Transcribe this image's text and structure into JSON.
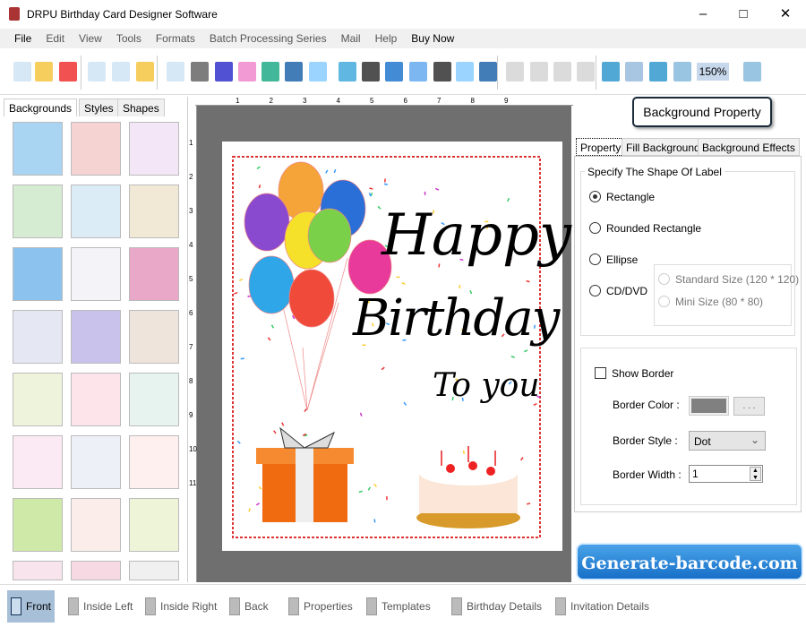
{
  "app": {
    "title": "DRPU Birthday Card Designer Software"
  },
  "menu": [
    "File",
    "Edit",
    "View",
    "Tools",
    "Formats",
    "Batch Processing Series",
    "Mail",
    "Help",
    "Buy Now"
  ],
  "toolbar": {
    "zoom": "150%",
    "icons": [
      "new-icon",
      "open-icon",
      "close-icon",
      "save-icon",
      "save-as-icon",
      "export-icon",
      "page-setup-icon",
      "print-icon",
      "copies-icon",
      "gift-icon",
      "image-icon",
      "pen-icon",
      "shape-icon",
      "watermark-icon",
      "barcode-icon",
      "text-icon",
      "word-art-icon",
      "signature-icon",
      "mail-icon",
      "line-icon",
      "cut-icon",
      "copy-icon",
      "paste-icon",
      "delete-icon",
      "grid-icon",
      "actual-size-icon",
      "fit-icon",
      "zoom-in-icon",
      "zoom-out-icon"
    ]
  },
  "left": {
    "tabs": [
      "Backgrounds",
      "Styles",
      "Shapes"
    ],
    "thumb_colors": [
      "#a9d4f2",
      "#f6d3d3",
      "#f3e7f7",
      "#d5ecd2",
      "#dcecf6",
      "#f2e8d6",
      "#8cc3ee",
      "#f3f3f8",
      "#eaa8c8",
      "#e5e8f2",
      "#c9c3ec",
      "#efe4dc",
      "#eef3dc",
      "#fde3ea",
      "#e7f3ee",
      "#fbeaf3",
      "#eef0f8",
      "#fff0f0",
      "#cfeaa8",
      "#fbeeea",
      "#eef4d8",
      "#f8e4ec",
      "#f6d9e3",
      "#f0f0f0"
    ]
  },
  "card": {
    "line1": "Happy",
    "line2": "Birthday",
    "line3": "To you"
  },
  "right": {
    "title": "Background Property",
    "tabs": [
      "Property",
      "Fill Background",
      "Background Effects"
    ],
    "group_title": "Specify The Shape Of Label",
    "shapes": [
      "Rectangle",
      "Rounded Rectangle",
      "Ellipse",
      "CD/DVD"
    ],
    "selected_shape": "Rectangle",
    "cd_sizes": [
      "Standard Size (120 * 120)",
      "Mini Size (80 * 80)"
    ],
    "show_border": "Show Border",
    "show_border_checked": false,
    "border_color_label": "Border Color :",
    "border_color": "#808080",
    "browse": ". . .",
    "border_style_label": "Border Style :",
    "border_style": "Dot",
    "border_width_label": "Border Width :",
    "border_width": "1"
  },
  "banner": "Generate-barcode.com",
  "bottom": [
    "Front",
    "Inside Left",
    "Inside Right",
    "Back",
    "Properties",
    "Templates",
    "Birthday Details",
    "Invitation Details"
  ]
}
